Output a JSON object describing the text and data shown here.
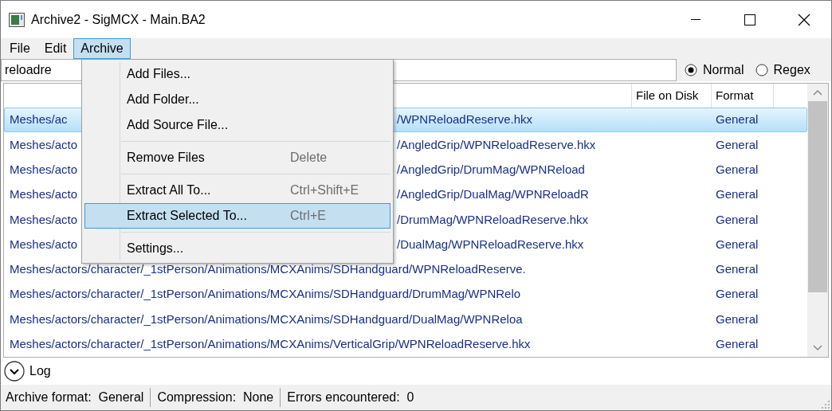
{
  "window": {
    "title": "Archive2 - SigMCX - Main.BA2"
  },
  "menubar": [
    {
      "label": "File",
      "selected": false
    },
    {
      "label": "Edit",
      "selected": false
    },
    {
      "label": "Archive",
      "selected": true
    }
  ],
  "menu": [
    {
      "kind": "item",
      "label": "Add Files...",
      "selected": false
    },
    {
      "kind": "item",
      "label": "Add Folder...",
      "selected": false
    },
    {
      "kind": "item",
      "label": "Add Source File...",
      "selected": false
    },
    {
      "kind": "separator"
    },
    {
      "kind": "item",
      "label": "Remove Files",
      "shortcut": "Delete",
      "selected": false
    },
    {
      "kind": "separator"
    },
    {
      "kind": "item",
      "label": "Extract All To...",
      "shortcut": "Ctrl+Shift+E",
      "selected": false
    },
    {
      "kind": "item",
      "label": "Extract Selected To...",
      "shortcut": "Ctrl+E",
      "selected": true
    },
    {
      "kind": "separator"
    },
    {
      "kind": "item",
      "label": "Settings...",
      "selected": false
    }
  ],
  "search": {
    "value": "reloadre",
    "modes": [
      {
        "label": "Normal",
        "selected": true
      },
      {
        "label": "Regex",
        "selected": false
      }
    ]
  },
  "table": {
    "columns": [
      "File on Disk",
      "Format"
    ],
    "rows": [
      {
        "path_parts": [
          "Meshes/ac",
          "/WPNReloadReserve.hkx"
        ],
        "format": "General",
        "selected": true
      },
      {
        "path_parts": [
          "Meshes/acto",
          "/AngledGrip/WPNReloadReserve.hkx"
        ],
        "format": "General",
        "selected": false
      },
      {
        "path_parts": [
          "Meshes/acto",
          "/AngledGrip/DrumMag/WPNReload"
        ],
        "format": "General",
        "selected": false
      },
      {
        "path_parts": [
          "Meshes/acto",
          "/AngledGrip/DualMag/WPNReloadR"
        ],
        "format": "General",
        "selected": false
      },
      {
        "path_parts": [
          "Meshes/acto",
          "/DrumMag/WPNReloadReserve.hkx"
        ],
        "format": "General",
        "selected": false
      },
      {
        "path_parts": [
          "Meshes/acto",
          "/DualMag/WPNReloadReserve.hkx"
        ],
        "format": "General",
        "selected": false
      },
      {
        "path_parts": [
          "Meshes/actors/character/_1stPerson/Animations/MCXAnims/SDHandguard/WPNReloadReserve."
        ],
        "format": "General",
        "selected": false
      },
      {
        "path_parts": [
          "Meshes/actors/character/_1stPerson/Animations/MCXAnims/SDHandguard/DrumMag/WPNRelo"
        ],
        "format": "General",
        "selected": false
      },
      {
        "path_parts": [
          "Meshes/actors/character/_1stPerson/Animations/MCXAnims/SDHandguard/DualMag/WPNReloa"
        ],
        "format": "General",
        "selected": false
      },
      {
        "path_parts": [
          "Meshes/actors/character/_1stPerson/Animations/MCXAnims/VerticalGrip/WPNReloadReserve.hkx"
        ],
        "format": "General",
        "selected": false
      }
    ]
  },
  "log": {
    "label": "Log",
    "expanded": false
  },
  "status_bar": [
    {
      "label": "Archive format:",
      "value": "General"
    },
    {
      "label": "Compression:",
      "value": "None"
    },
    {
      "label": "Errors encountered:",
      "value": "0"
    }
  ]
}
